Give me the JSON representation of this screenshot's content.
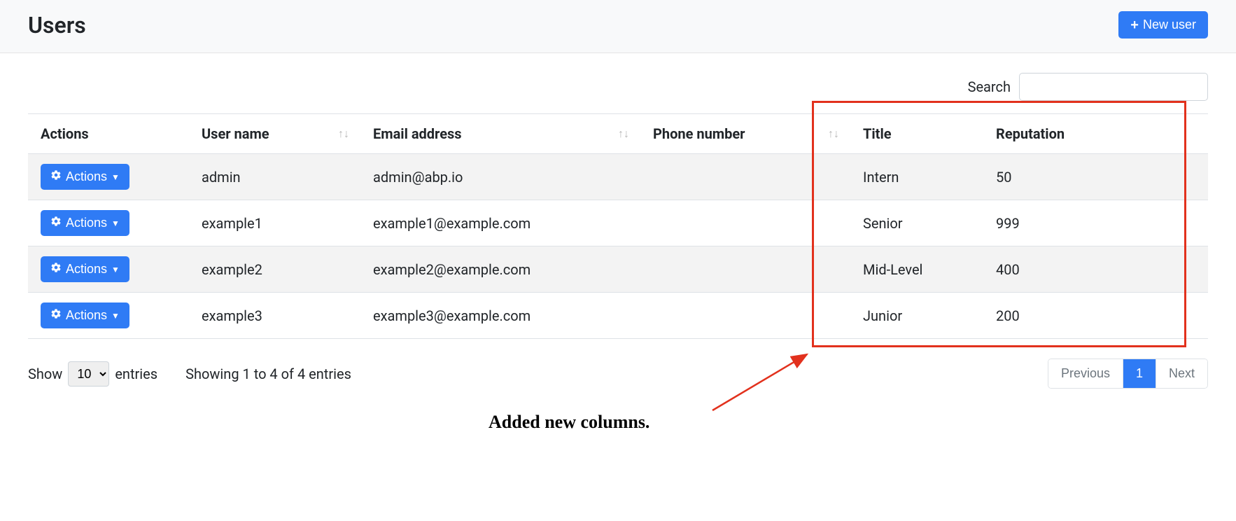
{
  "header": {
    "title": "Users",
    "new_user_label": "New user"
  },
  "search": {
    "label": "Search",
    "value": ""
  },
  "table": {
    "columns": {
      "actions": "Actions",
      "username": "User name",
      "email": "Email address",
      "phone": "Phone number",
      "title": "Title",
      "reputation": "Reputation"
    },
    "action_button_label": "Actions",
    "rows": [
      {
        "username": "admin",
        "email": "admin@abp.io",
        "phone": "",
        "title": "Intern",
        "reputation": "50"
      },
      {
        "username": "example1",
        "email": "example1@example.com",
        "phone": "",
        "title": "Senior",
        "reputation": "999"
      },
      {
        "username": "example2",
        "email": "example2@example.com",
        "phone": "",
        "title": "Mid-Level",
        "reputation": "400"
      },
      {
        "username": "example3",
        "email": "example3@example.com",
        "phone": "",
        "title": "Junior",
        "reputation": "200"
      }
    ]
  },
  "annotation": {
    "text": "Added new columns."
  },
  "footer": {
    "show_label": "Show",
    "entries_label": "entries",
    "page_size": "10",
    "info": "Showing 1 to 4 of 4 entries",
    "prev": "Previous",
    "next": "Next",
    "page": "1"
  }
}
